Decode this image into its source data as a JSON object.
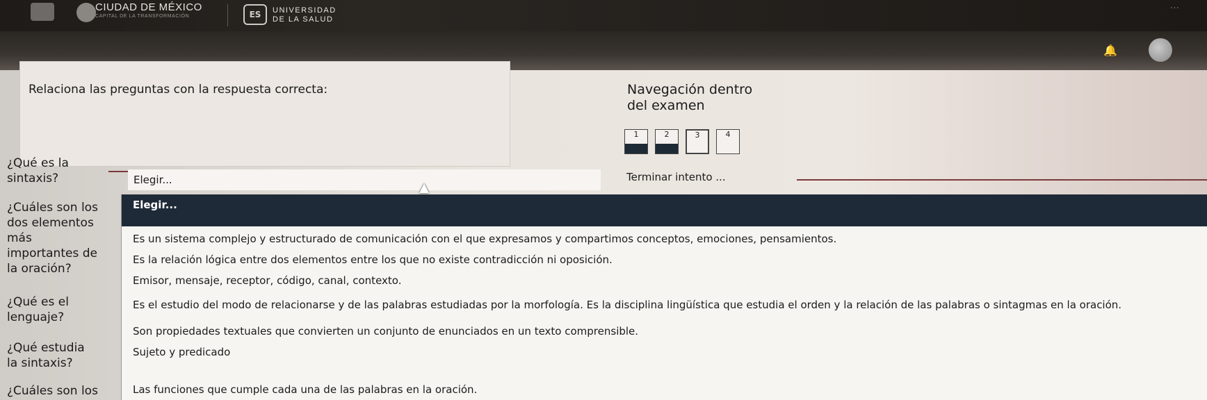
{
  "header": {
    "city": "CIUDAD DE MÉXICO",
    "city_sub": "CAPITAL DE LA TRANSFORMACIÓN",
    "uni_line1": "UNIVERSIDAD",
    "uni_line2": "DE LA SALUD",
    "uni_logo_text": "ES",
    "menu_dots": "..."
  },
  "quiz": {
    "prompt": "Relaciona las preguntas con la respuesta correcta:",
    "questions": [
      {
        "lines": [
          "¿Qué es la",
          "sintaxis?"
        ]
      },
      {
        "lines": [
          "¿Cuáles son los",
          "dos elementos",
          "más",
          "importantes de",
          "la oración?"
        ]
      },
      {
        "lines": [
          "¿Qué es el",
          "lenguaje?"
        ]
      },
      {
        "lines": [
          "¿Qué estudia",
          "la sintaxis?"
        ]
      },
      {
        "lines": [
          "¿Cuáles son los"
        ]
      }
    ],
    "select_value": "Elegir..."
  },
  "dropdown": {
    "options": [
      "Elegir...",
      "Es un sistema complejo y estructurado de comunicación con el que expresamos y compartimos conceptos, emociones, pensamientos.",
      "Es la relación lógica entre dos elementos entre los que no existe contradicción ni oposición.",
      "Emisor, mensaje, receptor, código, canal, contexto.",
      "Es el estudio del modo de relacionarse y de las palabras estudiadas por la morfología. Es la disciplina lingüística que estudia el orden y la relación de las palabras o sintagmas en la oración.",
      "Son propiedades textuales que convierten un conjunto de enunciados en un texto comprensible.",
      "Sujeto y predicado",
      "Las funciones que cumple cada una de las palabras en la oración."
    ],
    "selected_index": 0
  },
  "navigation": {
    "title_line1": "Navegación dentro",
    "title_line2": "del examen",
    "pages": [
      {
        "label": "1",
        "answered": true
      },
      {
        "label": "2",
        "answered": true
      },
      {
        "label": "3",
        "answered": false
      },
      {
        "label": "4",
        "answered": false
      }
    ],
    "finish_label": "Terminar intento ..."
  }
}
